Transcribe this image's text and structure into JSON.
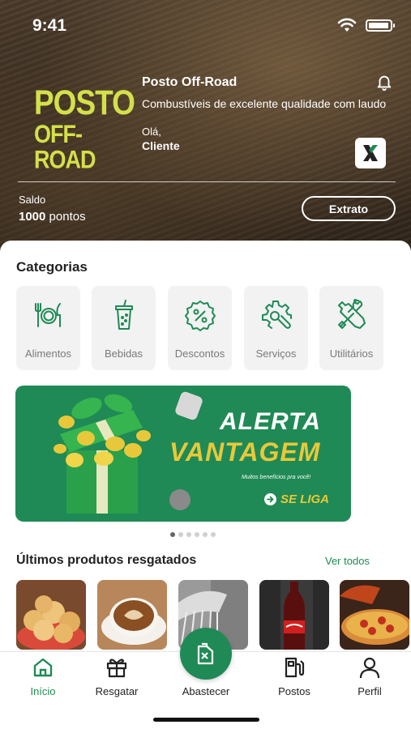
{
  "status_bar": {
    "time": "9:41"
  },
  "header": {
    "logo_line1": "POSTO",
    "logo_line2": "OFF-ROAD",
    "store_name": "Posto Off-Road",
    "store_description": "Combustíveis de excelente qualidade com laudo",
    "greeting": "Olá,",
    "user_name": "Cliente",
    "balance_label": "Saldo",
    "balance_value": "1000",
    "balance_unit": "pontos",
    "statement_button": "Extrato"
  },
  "categories": {
    "title": "Categorias",
    "items": [
      {
        "label": "Alimentos",
        "icon": "utensils-icon"
      },
      {
        "label": "Bebidas",
        "icon": "drink-cup-icon"
      },
      {
        "label": "Descontos",
        "icon": "discount-badge-icon"
      },
      {
        "label": "Serviços",
        "icon": "gear-wrench-icon"
      },
      {
        "label": "Utilitários",
        "icon": "tools-icon"
      }
    ]
  },
  "banner": {
    "line1": "ALERTA",
    "line2": "VANTAGEM",
    "subtitle": "Muitos benefícios pra você!",
    "cta": "SE LIGA",
    "slide_index": 1,
    "slide_count": 6
  },
  "products": {
    "title": "Últimos produtos resgatados",
    "see_all": "Ver todos",
    "items": [
      {
        "icon": "cheese-bread-image"
      },
      {
        "icon": "coffee-image"
      },
      {
        "icon": "car-wash-image"
      },
      {
        "icon": "soda-bottle-image"
      },
      {
        "icon": "pizza-image"
      }
    ]
  },
  "tab_bar": {
    "items": [
      {
        "label": "Início",
        "icon": "home-icon",
        "active": true
      },
      {
        "label": "Resgatar",
        "icon": "gift-icon",
        "active": false
      },
      {
        "label": "Abastecer",
        "icon": "fuel-can-icon",
        "active": false
      },
      {
        "label": "Postos",
        "icon": "gas-station-icon",
        "active": false
      },
      {
        "label": "Perfil",
        "icon": "user-icon",
        "active": false
      }
    ]
  },
  "colors": {
    "brand_green": "#1f8a55",
    "logo_yellow": "#d4e04a",
    "banner_yellow": "#e8c83a"
  }
}
